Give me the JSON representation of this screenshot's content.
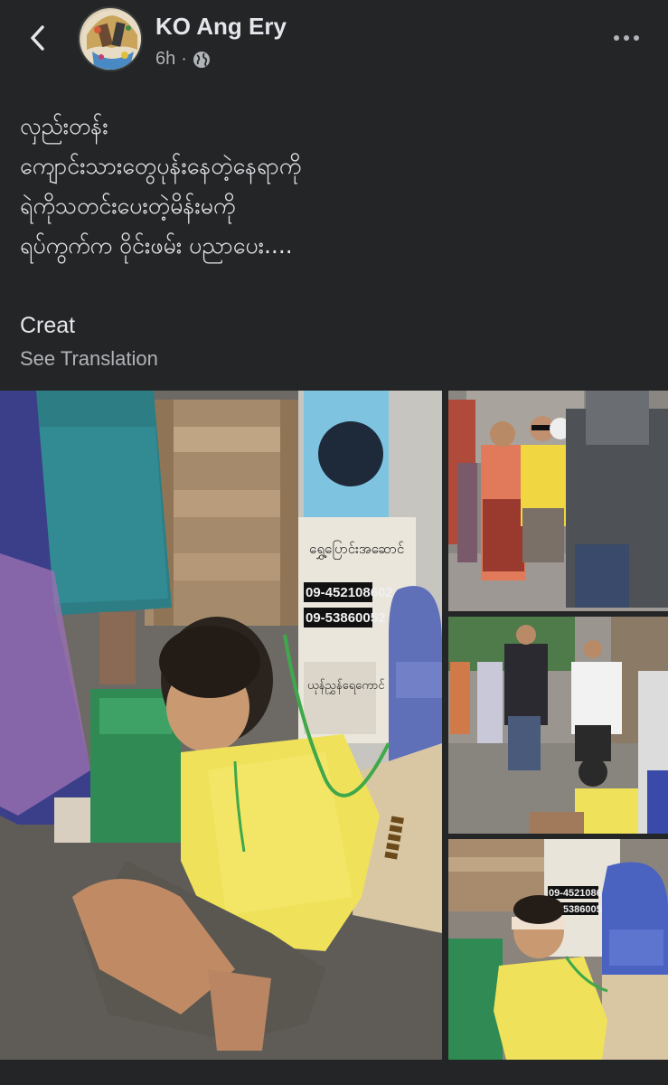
{
  "header": {
    "author_name": "KO Ang Ery",
    "time": "6h",
    "separator": "·",
    "privacy_icon": "globe-icon",
    "back_icon": "chevron-left-icon",
    "more_icon": "more-horizontal-icon"
  },
  "post": {
    "lines": [
      "လှည်းတန်း",
      "ကျောင်းသားတွေပုန်းနေတဲ့နေရာကို",
      "ရဲကိုသတင်းပေးတဲ့မိန်းမကို",
      "ရပ်ကွက်က ဝိုင်းဖမ်း ပညာပေး...."
    ],
    "credit": "Creat",
    "see_translation": "See Translation"
  },
  "photos": {
    "main": {
      "poster_top_text": "ယုန်ညွှန်ရေကောင်",
      "poster_phone_1": "09-452108602",
      "poster_phone_2": "09-53860052",
      "poster_label": "ရွှေ့ပြောင်းအဆောင်"
    },
    "bottom_right": {
      "poster_phone_1": "09-452108602",
      "poster_phone_2": "09-53860052"
    }
  },
  "colors": {
    "background": "#242526",
    "text_primary": "#e4e6eb",
    "text_secondary": "#b0b3b8"
  }
}
